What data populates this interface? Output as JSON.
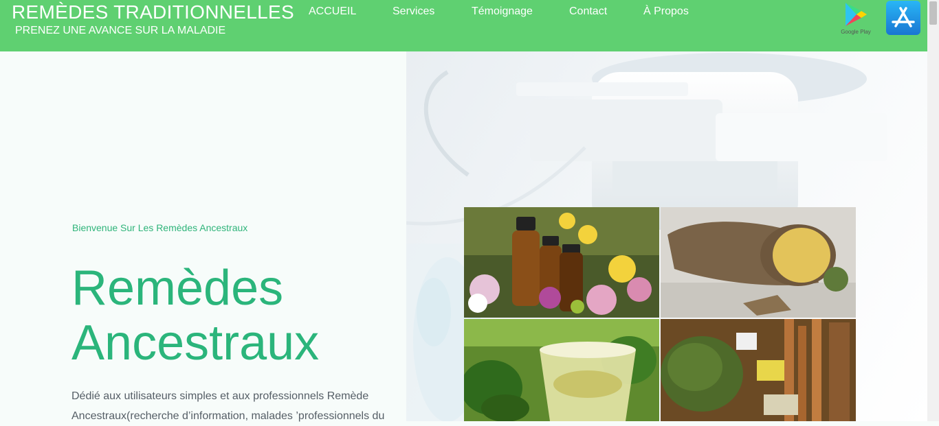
{
  "header": {
    "title": "REMÈDES TRADITIONNELLES",
    "tagline": "PRENEZ UNE AVANCE SUR LA MALADIE",
    "nav": [
      {
        "label": "ACCUEIL"
      },
      {
        "label": "Services"
      },
      {
        "label": "Témoignage"
      },
      {
        "label": "Contact"
      },
      {
        "label": "À Propos"
      }
    ],
    "google_play_label": "Google Play"
  },
  "hero": {
    "welcome": "Bienvenue Sur Les Remèdes Ancestraux",
    "title_line1": "Remèdes",
    "title_line2": "Ancestraux",
    "description": "Dédié aux utilisateurs simples et aux professionnels Remède Ancestraux(recherche d’information, malades ’professionnels du"
  },
  "gallery": [
    {
      "name": "essential-oils-flowers-photo"
    },
    {
      "name": "yam-root-photo"
    },
    {
      "name": "herbal-tea-mint-photo"
    },
    {
      "name": "dried-herbs-market-photo"
    }
  ],
  "colors": {
    "header_bg": "#5fd071",
    "accent_green": "#2bb57b",
    "text_gray": "#555e66",
    "page_bg": "#f7fcfa"
  }
}
